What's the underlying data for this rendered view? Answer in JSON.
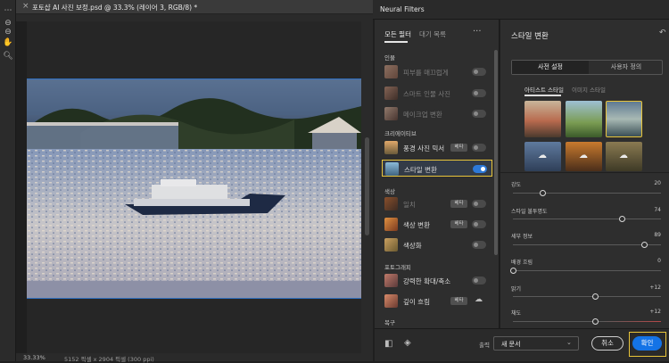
{
  "document": {
    "tab_title": "포토샵 AI 사진 보정.psd @ 33.3% (레이어 3, RGB/8) *",
    "close": "×",
    "zoom": "33.33%",
    "info": "5152 픽셀 x 2904 픽셀 (300 ppi)"
  },
  "neural_filters": {
    "window_title": "Neural Filters",
    "list": {
      "tabs": [
        "모든 필터",
        "대기 목록"
      ],
      "more": "···",
      "categories": {
        "portrait": "인물",
        "creative": "크리에이티브",
        "color": "색상",
        "photography": "포토그래피",
        "restoration": "복구"
      },
      "items": {
        "skin_smoothing": "피부를 매끄럽게",
        "smart_portrait": "스마트 인물 사진",
        "makeup_transfer": "메이크업 변환",
        "landscape_mixer": "풍경 사진 믹서",
        "style_transfer": "스타일 변환",
        "harmonization": "일치",
        "color_transfer": "색상 변환",
        "colorize": "색상화",
        "super_zoom": "강력한 확대/축소",
        "depth_blur": "깊이 흐림"
      },
      "beta_badge": "베타"
    },
    "settings": {
      "title": "스타일 변환",
      "reset": "↶",
      "segments": [
        "사전 설정",
        "사용자 정의"
      ],
      "subtabs": [
        "아티스트 스타일",
        "이미지 스타일"
      ],
      "cloud_glyph": "☁",
      "sliders": [
        {
          "label": "강도",
          "value": "20",
          "level": 0.2
        },
        {
          "label": "스타일 불투명도",
          "value": "74",
          "level": 0.74
        },
        {
          "label": "세부 정보",
          "value": "89",
          "level": 0.89
        },
        {
          "label": "배경 흐림",
          "value": "0",
          "level": 0.0
        },
        {
          "label": "밝기",
          "value": "+12",
          "level": 0.56
        },
        {
          "label": "채도",
          "value": "+12",
          "level": 0.56
        }
      ]
    },
    "footer": {
      "output_label": "출력",
      "output_value": "새 문서",
      "chevron": "⌄",
      "cancel": "취소",
      "ok": "확인"
    }
  },
  "colors": {
    "accent": "#1473e6",
    "highlight": "#e8c43a",
    "toggle_on": "#2d79d8"
  },
  "icons": {
    "tools": [
      "dots-icon",
      "zoom-minus-icon",
      "hand-icon",
      "zoom-icon"
    ],
    "bottom": [
      "compare-icon",
      "layers-icon"
    ]
  }
}
